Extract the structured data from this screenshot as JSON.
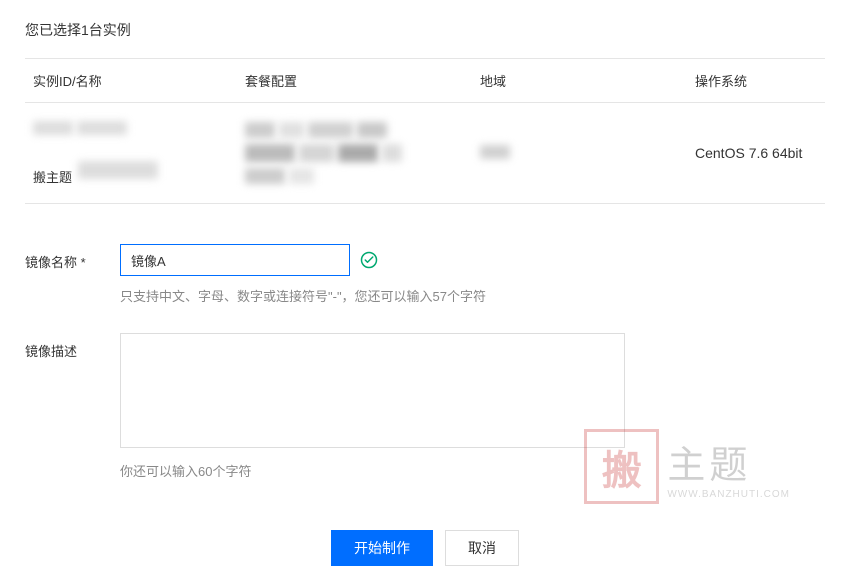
{
  "header": {
    "selection_text": "您已选择1台实例"
  },
  "table": {
    "headers": {
      "instance_id": "实例ID/名称",
      "package": "套餐配置",
      "region": "地域",
      "os": "操作系统"
    },
    "rows": [
      {
        "instance_label": "搬主题",
        "os": "CentOS 7.6 64bit"
      }
    ]
  },
  "form": {
    "image_name": {
      "label": "镜像名称 *",
      "value": "镜像A",
      "hint": "只支持中文、字母、数字或连接符号\"-\"，您还可以输入57个字符"
    },
    "image_desc": {
      "label": "镜像描述",
      "value": "",
      "hint": "你还可以输入60个字符"
    }
  },
  "buttons": {
    "confirm": "开始制作",
    "cancel": "取消"
  },
  "watermark": {
    "stamp": "搬",
    "title": "主题",
    "url": "WWW.BANZHUTI.COM"
  }
}
